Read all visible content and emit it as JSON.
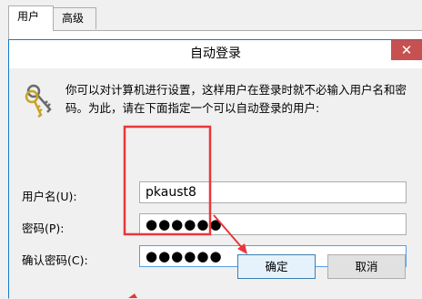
{
  "tabs": [
    {
      "label": "用户",
      "active": true
    },
    {
      "label": "高级",
      "active": false
    }
  ],
  "dialog": {
    "title": "自动登录",
    "close_label": "✕",
    "description": "你可以对计算机进行设置，这样用户在登录时就不必输入用户名和密码。为此，请在下面指定一个可以自动登录的用户:",
    "fields": {
      "username": {
        "label": "用户名(U):",
        "value": "pkaust8"
      },
      "password": {
        "label": "密码(P):",
        "value": "●●●●●●"
      },
      "confirm": {
        "label": "确认密码(C):",
        "value": "●●●●●●"
      }
    },
    "buttons": {
      "ok": "确定",
      "cancel": "取消"
    }
  },
  "colors": {
    "accent": "#1979ca",
    "annotation": "#e8373a",
    "close": "#c75050"
  },
  "icons": {
    "dialog": "keys-icon",
    "close": "close-icon"
  }
}
